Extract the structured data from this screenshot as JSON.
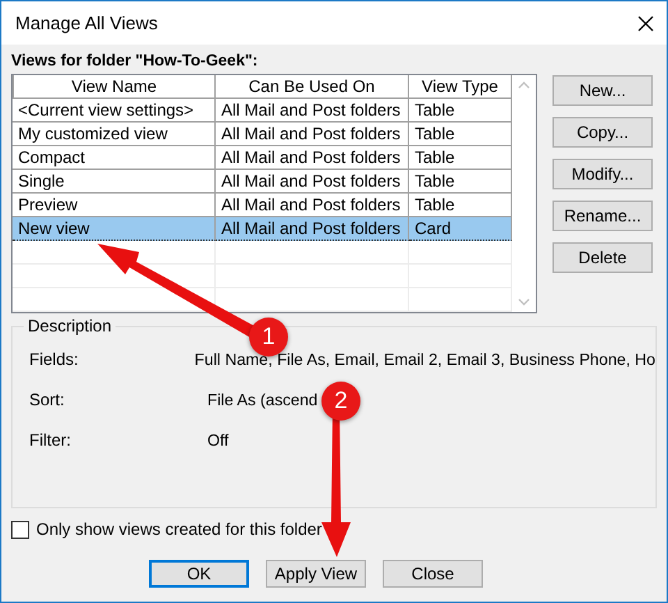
{
  "window": {
    "title": "Manage All Views"
  },
  "views_label": "Views for folder \"How-To-Geek\":",
  "table": {
    "columns": [
      "View Name",
      "Can Be Used On",
      "View Type"
    ],
    "rows": [
      {
        "cells": [
          "<Current view settings>",
          "All Mail and Post folders",
          "Table"
        ],
        "selected": false
      },
      {
        "cells": [
          "My customized view",
          "All Mail and Post folders",
          "Table"
        ],
        "selected": false
      },
      {
        "cells": [
          "Compact",
          "All Mail and Post folders",
          "Table"
        ],
        "selected": false
      },
      {
        "cells": [
          "Single",
          "All Mail and Post folders",
          "Table"
        ],
        "selected": false
      },
      {
        "cells": [
          "Preview",
          "All Mail and Post folders",
          "Table"
        ],
        "selected": false
      },
      {
        "cells": [
          "New view",
          "All Mail and Post folders",
          "Card"
        ],
        "selected": true
      }
    ]
  },
  "side_buttons": [
    "New...",
    "Copy...",
    "Modify...",
    "Rename...",
    "Delete"
  ],
  "description": {
    "title": "Description",
    "rows": [
      {
        "label": "Fields:",
        "value": "Full Name, File As, Email, Email 2, Email 3, Business Phone, Ho"
      },
      {
        "label": "Sort:",
        "value": "File As (ascend"
      },
      {
        "label": "Filter:",
        "value": "Off"
      }
    ]
  },
  "only_show_checkbox": {
    "label": "Only show views created for this folder",
    "checked": false
  },
  "buttons": [
    {
      "label": "OK",
      "default": true
    },
    {
      "label": "Apply View",
      "default": false
    },
    {
      "label": "Close",
      "default": false
    }
  ],
  "annotations": [
    {
      "number": "1"
    },
    {
      "number": "2"
    }
  ]
}
